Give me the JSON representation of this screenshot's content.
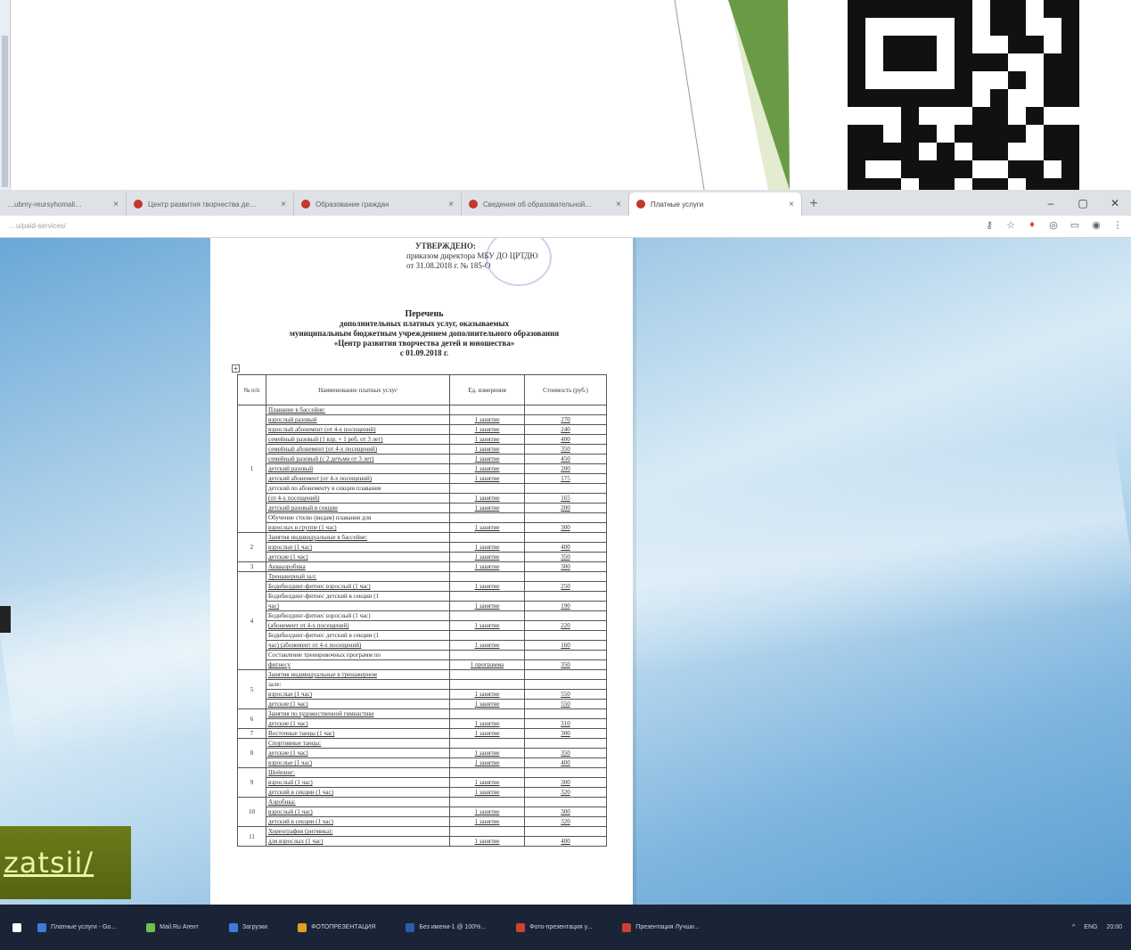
{
  "slide": {
    "link_text": "zatsii/"
  },
  "browser": {
    "tabs": [
      {
        "label": "…ubmy-reursyhomali…",
        "close": "×"
      },
      {
        "label": "Центр развития творчества де…",
        "close": "×"
      },
      {
        "label": "Образование граждан",
        "close": "×"
      },
      {
        "label": "Сведения об образовательной…",
        "close": "×"
      },
      {
        "label": "Платные услуги",
        "close": "×",
        "active": true
      }
    ],
    "new_tab": "+",
    "window_controls": [
      "–",
      "▢",
      "✕"
    ],
    "url": "…u/paid-services/",
    "toolbar_icons": [
      "key-icon",
      "star-icon",
      "extension-icon",
      "extension-icon",
      "cast-icon",
      "profile-icon",
      "menu-icon"
    ]
  },
  "document": {
    "approval": {
      "line1": "УТВЕРЖДЕНО:",
      "line2": "приказом директора МБУ ДО ЦРТДЮ",
      "line3": "от 31.08.2018 г. № 185-О"
    },
    "heading": {
      "line1": "Перечень",
      "line2": "дополнительных платных услуг, оказываемых",
      "line3": "муниципальным бюджетным учреждением дополнительного образования",
      "line4": "«Центр развития творчества детей и юношества»",
      "line5": "с 01.09.2018 г."
    },
    "table": {
      "headers": [
        "№ п/п",
        "Наименование платных услуг",
        "Ед. измерения",
        "Стоимость (руб.)"
      ],
      "groups": [
        {
          "num": "1",
          "rows": [
            {
              "name": "Плавание в бассейне:",
              "unit": "",
              "price": ""
            },
            {
              "name": "взрослый разовый",
              "unit": "1 занятие",
              "price": "270"
            },
            {
              "name": "взрослый абонемент (от 4-х посещений)",
              "unit": "1 занятие",
              "price": "240"
            },
            {
              "name": "семейный разовый (1 взр. + 1 реб. от 3 лет)",
              "unit": "1 занятие",
              "price": "400"
            },
            {
              "name": "семейный абонемент (от 4-х посещений)",
              "unit": "1 занятие",
              "price": "350"
            },
            {
              "name": "семейный разовый (с 2 детьми от 3 лет)",
              "unit": "1 занятие",
              "price": "450"
            },
            {
              "name": "детский разовый",
              "unit": "1 занятие",
              "price": "200"
            },
            {
              "name": "детский абонемент (от 4-х посещений)",
              "unit": "1 занятие",
              "price": "175"
            },
            {
              "name": "детский по абонементу в секции плавания",
              "unit": "",
              "price": ""
            },
            {
              "name": "(от 4-х посещений)",
              "unit": "1 занятие",
              "price": "165"
            },
            {
              "name": "детский разовый в секции",
              "unit": "1 занятие",
              "price": "200"
            },
            {
              "name": "Обучение стилю (видам) плавания для",
              "unit": "",
              "price": ""
            },
            {
              "name": "взрослых в группе (1 час)",
              "unit": "1 занятие",
              "price": "300"
            }
          ]
        },
        {
          "num": "2",
          "rows": [
            {
              "name": "Занятия индивидуальные в бассейне:",
              "unit": "",
              "price": ""
            },
            {
              "name": "взрослые (1 час)",
              "unit": "1 занятие",
              "price": "400"
            },
            {
              "name": "детские (1 час)",
              "unit": "1 занятие",
              "price": "350"
            }
          ]
        },
        {
          "num": "3",
          "rows": [
            {
              "name": "Аквааэробика",
              "unit": "1 занятие",
              "price": "300"
            }
          ]
        },
        {
          "num": "4",
          "rows": [
            {
              "name": "Тренажерный зал:",
              "unit": "",
              "price": ""
            },
            {
              "name": "Бодибилдинг-фитнес взрослый (1 час)",
              "unit": "1 занятие",
              "price": "250"
            },
            {
              "name": "Бодибилдинг-фитнес детский в секции (1",
              "unit": "",
              "price": ""
            },
            {
              "name": "час)",
              "unit": "1 занятие",
              "price": "190"
            },
            {
              "name": "Бодибилдинг-фитнес взрослый (1 час)",
              "unit": "",
              "price": ""
            },
            {
              "name": "(абонемент от 4-х посещений)",
              "unit": "1 занятие",
              "price": "220"
            },
            {
              "name": "Бодибилдинг-фитнес детский в секции (1",
              "unit": "",
              "price": ""
            },
            {
              "name": "час) (абонемент от 4-х посещений)",
              "unit": "1 занятие",
              "price": "160"
            },
            {
              "name": "Составление тренировочных программ по",
              "unit": "",
              "price": ""
            },
            {
              "name": "фитнесу",
              "unit": "1 программа",
              "price": "350"
            }
          ]
        },
        {
          "num": "5",
          "rows": [
            {
              "name": "Занятия индивидуальные в тренажерном",
              "unit": "",
              "price": ""
            },
            {
              "name": "зале:",
              "unit": "",
              "price": ""
            },
            {
              "name": "взрослые (1 час)",
              "unit": "1 занятие",
              "price": "550"
            },
            {
              "name": "детские (1 час)",
              "unit": "1 занятие",
              "price": "550"
            }
          ]
        },
        {
          "num": "6",
          "rows": [
            {
              "name": "Занятия по художественной гимнастике",
              "unit": "",
              "price": ""
            },
            {
              "name": "детские (1 час)",
              "unit": "1 занятие",
              "price": "310"
            }
          ]
        },
        {
          "num": "7",
          "rows": [
            {
              "name": "Восточные танцы (1 час)",
              "unit": "1 занятие",
              "price": "300"
            }
          ]
        },
        {
          "num": "8",
          "rows": [
            {
              "name": "Спортивные танцы:",
              "unit": "",
              "price": ""
            },
            {
              "name": "детские (1 час)",
              "unit": "1 занятие",
              "price": "350"
            },
            {
              "name": "взрослые (1 час)",
              "unit": "1 занятие",
              "price": "400"
            }
          ]
        },
        {
          "num": "9",
          "rows": [
            {
              "name": "Шейпинг:",
              "unit": "",
              "price": ""
            },
            {
              "name": "взрослый (1 час)",
              "unit": "1 занятие",
              "price": "300"
            },
            {
              "name": "детский в секции (1 час)",
              "unit": "1 занятие",
              "price": "320"
            }
          ]
        },
        {
          "num": "10",
          "rows": [
            {
              "name": "Аэробика:",
              "unit": "",
              "price": ""
            },
            {
              "name": "взрослый (1 час)",
              "unit": "1 занятие",
              "price": "300"
            },
            {
              "name": "детский в секции (1 час)",
              "unit": "1 занятие",
              "price": "320"
            }
          ]
        },
        {
          "num": "11",
          "rows": [
            {
              "name": "Хореография (ритмика):",
              "unit": "",
              "price": ""
            },
            {
              "name": "для взрослых (1 час)",
              "unit": "1 занятие",
              "price": "400"
            }
          ]
        }
      ]
    }
  },
  "taskbar": {
    "items": [
      "Платные услуги - Go...",
      "Mail.Ru Агент",
      "Загрузки",
      "ФОТОПРЕЗЕНТАЦИЯ",
      "Без имени-1 @ 100%...",
      "Фото-презентация у...",
      "Презентация Лучши..."
    ],
    "tray": [
      "^",
      "ENG",
      "20:00"
    ]
  },
  "colors": {
    "green_dark": "#6b9a46",
    "green_light": "#e3ebd0",
    "link_bg": "#5e6e14",
    "link_text": "#e9f4a8",
    "taskbar": "#1b2436"
  }
}
